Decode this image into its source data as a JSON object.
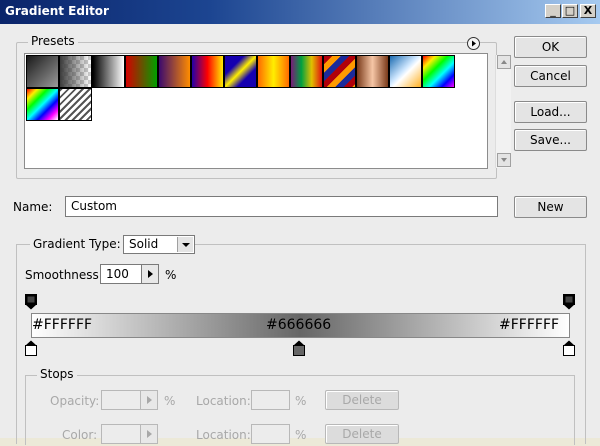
{
  "window": {
    "title": "Gradient Editor",
    "minimize_glyph": "_",
    "maximize_glyph": "□",
    "close_glyph": "X"
  },
  "presets": {
    "label": "Presets",
    "menu_icon": "circle-arrow-right-icon"
  },
  "buttons": {
    "ok": "OK",
    "cancel": "Cancel",
    "load": "Load...",
    "save": "Save...",
    "new": "New"
  },
  "name": {
    "label": "Name:",
    "value": "Custom"
  },
  "gradient_type": {
    "label": "Gradient Type:",
    "value": "Solid"
  },
  "smoothness": {
    "label": "Smoothness:",
    "value": "100",
    "unit": "%"
  },
  "gradient": {
    "left_label": "#FFFFFF",
    "mid_label": "#666666",
    "right_label": "#FFFFFF",
    "start_color": "#FFFFFF",
    "mid_color": "#666666",
    "end_color": "#FFFFFF"
  },
  "stops": {
    "label": "Stops",
    "opacity_label": "Opacity:",
    "opacity_unit": "%",
    "color_label": "Color:",
    "location_label": "Location:",
    "location_unit": "%",
    "delete_label": "Delete"
  }
}
